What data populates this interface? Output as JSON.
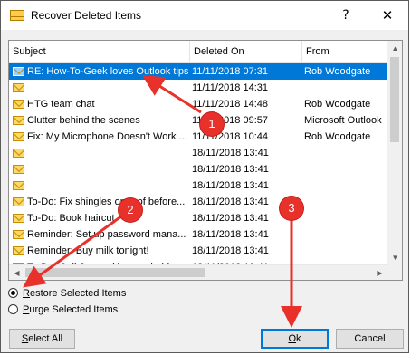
{
  "window": {
    "title": "Recover Deleted Items",
    "help_glyph": "?",
    "close_glyph": "✕"
  },
  "list": {
    "columns": [
      "Subject",
      "Deleted On",
      "From"
    ],
    "rows": [
      {
        "subject": "RE: How-To-Geek loves Outlook tips",
        "date": "11/11/2018 07:31",
        "from": "Rob Woodgate",
        "selected": true
      },
      {
        "subject": "",
        "date": "11/11/2018 14:31",
        "from": ""
      },
      {
        "subject": "HTG team chat",
        "date": "11/11/2018 14:48",
        "from": "Rob Woodgate"
      },
      {
        "subject": "Clutter behind the scenes",
        "date": "11/11/2018 09:57",
        "from": "Microsoft Outlook"
      },
      {
        "subject": "Fix: My Microphone Doesn't Work ...",
        "date": "11/11/2018 10:44",
        "from": "Rob Woodgate"
      },
      {
        "subject": "",
        "date": "18/11/2018 13:41",
        "from": ""
      },
      {
        "subject": "",
        "date": "18/11/2018 13:41",
        "from": ""
      },
      {
        "subject": "",
        "date": "18/11/2018 13:41",
        "from": ""
      },
      {
        "subject": "To-Do: Fix shingles on roof before...",
        "date": "18/11/2018 13:41",
        "from": ""
      },
      {
        "subject": "To-Do: Book haircut",
        "date": "18/11/2018 13:41",
        "from": ""
      },
      {
        "subject": "Reminder: Set up password mana...",
        "date": "18/11/2018 13:41",
        "from": ""
      },
      {
        "subject": "Reminder: Buy milk tonight!",
        "date": "18/11/2018 13:41",
        "from": ""
      },
      {
        "subject": "To-Do: Call Jon and borrow ladder",
        "date": "18/11/2018 13:41",
        "from": ""
      }
    ]
  },
  "options": {
    "restore": {
      "label": "Restore Selected Items",
      "accel": "R",
      "rest": "estore Selected Items",
      "checked": true
    },
    "purge": {
      "label": "Purge Selected Items",
      "accel": "P",
      "rest": "urge Selected Items",
      "checked": false
    }
  },
  "buttons": {
    "select_all": {
      "label": "Select All",
      "accel": "S",
      "rest": "elect All"
    },
    "ok": {
      "label": "Ok",
      "accel": "O",
      "rest": "k"
    },
    "cancel": {
      "label": "Cancel"
    }
  },
  "annotations": {
    "badges": [
      "1",
      "2",
      "3"
    ],
    "color": "#e8312b"
  },
  "colors": {
    "selection": "#0078d7",
    "accent": "#0078d7"
  }
}
